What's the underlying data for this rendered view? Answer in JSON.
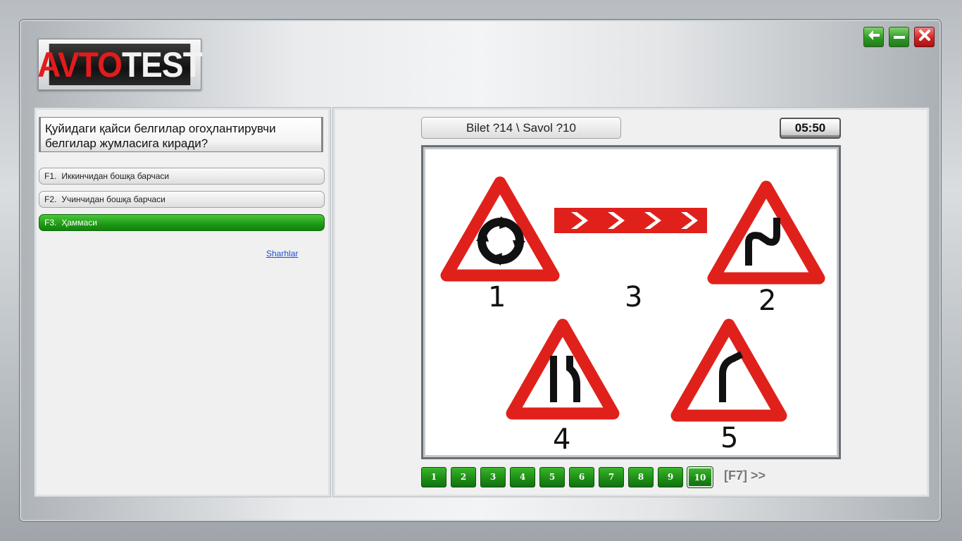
{
  "app": {
    "logo_part1": "AVTO",
    "logo_part2": "TEST"
  },
  "window_buttons": {
    "back_icon": "arrow-left-icon",
    "minimize_icon": "minimize-icon",
    "close_icon": "close-icon"
  },
  "question": {
    "text": "Қуйидаги қайси белгилар огоҳлантирувчи белгилар жумласига киради?"
  },
  "answers": [
    {
      "key": "F1.",
      "label": "Иккинчидан бошқа барчаси",
      "selected": false
    },
    {
      "key": "F2.",
      "label": "Учинчидан бошқа барчаси",
      "selected": false
    },
    {
      "key": "F3.",
      "label": "Ҳаммаси",
      "selected": true
    }
  ],
  "comments_link": "Sharhlar",
  "ticket_label": "Bilet ?14 \\ Savol ?10",
  "timer": "05:50",
  "signs": {
    "labels": [
      "1",
      "3",
      "2",
      "4",
      "5"
    ],
    "colors": {
      "red": "#e0211b",
      "black": "#111111"
    }
  },
  "navigation": {
    "questions": [
      "1",
      "2",
      "3",
      "4",
      "5",
      "6",
      "7",
      "8",
      "9",
      "10"
    ],
    "current": "10",
    "next_label": "[F7] >>"
  },
  "colors": {
    "accent_green": "#1d9a15",
    "close_red": "#d42222"
  }
}
